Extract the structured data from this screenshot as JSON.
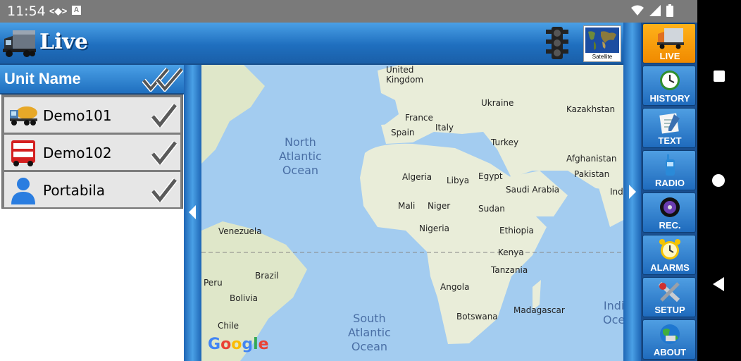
{
  "status_bar": {
    "time": "11:54",
    "icon_a": "A"
  },
  "header": {
    "title": "Live",
    "satellite_label": "Satellite"
  },
  "unit_panel": {
    "title": "Unit Name",
    "units": [
      {
        "name": "Demo101",
        "icon": "tanker-truck-icon"
      },
      {
        "name": "Demo102",
        "icon": "bus-icon"
      },
      {
        "name": "Portabila",
        "icon": "person-icon"
      }
    ]
  },
  "map": {
    "oceans": {
      "north_atlantic": "North\nAtlantic\nOcean",
      "south_atlantic": "South\nAtlantic\nOcean",
      "indian_partial": "Indi\nOce"
    },
    "labels": {
      "uk": "United\nKingdom",
      "ukraine": "Ukraine",
      "france": "France",
      "kazakhstan": "Kazakhstan",
      "italy": "Italy",
      "spain": "Spain",
      "turkey": "Turkey",
      "afghanistan": "Afghanistan",
      "pakistan": "Pakistan",
      "india_partial": "Indi",
      "algeria": "Algeria",
      "libya": "Libya",
      "egypt": "Egypt",
      "saudi": "Saudi Arabia",
      "mali": "Mali",
      "niger": "Niger",
      "sudan": "Sudan",
      "nigeria": "Nigeria",
      "ethiopia": "Ethiopia",
      "venezuela": "Venezuela",
      "kenya": "Kenya",
      "tanzania": "Tanzania",
      "brazil": "Brazil",
      "peru": "Peru",
      "bolivia": "Bolivia",
      "angola": "Angola",
      "madagascar": "Madagascar",
      "botswana": "Botswana",
      "chile": "Chile"
    },
    "google": "Google"
  },
  "nav": [
    {
      "label": "LIVE",
      "icon": "truck-icon",
      "active": true
    },
    {
      "label": "HISTORY",
      "icon": "clock-icon",
      "active": false
    },
    {
      "label": "TEXT",
      "icon": "notepad-icon",
      "active": false
    },
    {
      "label": "RADIO",
      "icon": "radio-icon",
      "active": false
    },
    {
      "label": "REC.",
      "icon": "record-disc-icon",
      "active": false
    },
    {
      "label": "ALARMS",
      "icon": "alarm-clock-icon",
      "active": false
    },
    {
      "label": "SETUP",
      "icon": "tools-icon",
      "active": false
    },
    {
      "label": "ABOUT",
      "icon": "globe-truck-icon",
      "active": false
    }
  ],
  "colors": {
    "header_blue": "#1f6fbf",
    "active_orange": "#f5a000",
    "ocean": "#a3ccf0",
    "land": "#e9edd9"
  }
}
